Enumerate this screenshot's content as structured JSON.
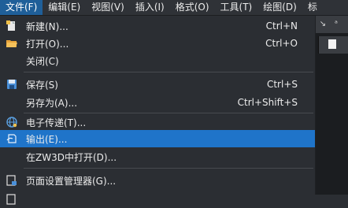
{
  "menubar": {
    "items": [
      "文件(F)",
      "编辑(E)",
      "视图(V)",
      "插入(I)",
      "格式(O)",
      "工具(T)",
      "绘图(D)",
      "标"
    ]
  },
  "file_menu": {
    "items": [
      {
        "label": "新建(N)...",
        "shortcut": "Ctrl+N",
        "icon": "new-file-icon"
      },
      {
        "label": "打开(O)...",
        "shortcut": "Ctrl+O",
        "icon": "open-folder-icon"
      },
      {
        "label": "关闭(C)",
        "shortcut": "",
        "icon": ""
      },
      {
        "label": "保存(S)",
        "shortcut": "Ctrl+S",
        "icon": "save-disk-icon"
      },
      {
        "label": "另存为(A)...",
        "shortcut": "Ctrl+Shift+S",
        "icon": ""
      },
      {
        "label": "电子传递(T)...",
        "shortcut": "",
        "icon": "etransmit-globe-icon"
      },
      {
        "label": "输出(E)...",
        "shortcut": "",
        "icon": "export-icon",
        "highlighted": true
      },
      {
        "label": "在ZW3D中打开(D)...",
        "shortcut": "",
        "icon": ""
      },
      {
        "label": "页面设置管理器(G)...",
        "shortcut": "",
        "icon": "page-setup-icon"
      }
    ]
  },
  "right_strip": {
    "icon_labels": [
      "↘",
      "ᵃ"
    ]
  },
  "colors": {
    "menu_bg": "#2b2e33",
    "highlight": "#1f74c9",
    "menubar_active": "#1f5f99",
    "text": "#ececec"
  }
}
